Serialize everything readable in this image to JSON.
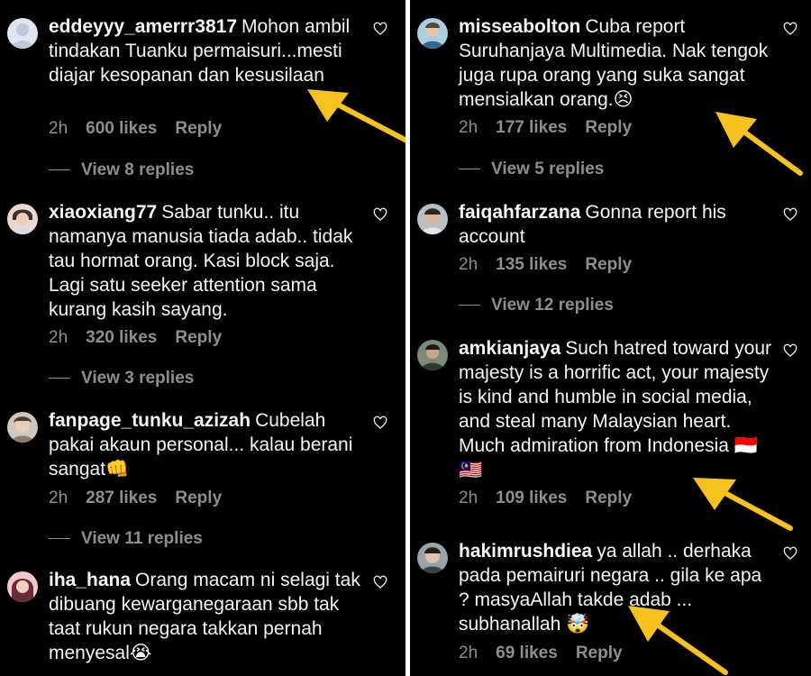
{
  "accent_color": "#f7c21e",
  "left_comments": [
    {
      "username": "eddeyyy_amerrr3817",
      "text": "Mohon ambil tindakan Tuanku permaisuri...mesti diajar kesopanan dan kesusilaan",
      "time": "2h",
      "likes": "600 likes",
      "reply": "Reply",
      "view_replies": "View 8 replies"
    },
    {
      "username": "xiaoxiang77",
      "text": "Sabar tunku.. itu namanya manusia tiada adab.. tidak tau hormat orang. Kasi block saja. Lagi satu seeker attention sama kurang kasih sayang.",
      "time": "2h",
      "likes": "320 likes",
      "reply": "Reply",
      "view_replies": "View 3 replies"
    },
    {
      "username": "fanpage_tunku_azizah",
      "text": "Cubelah pakai akaun personal... kalau berani sangat👊",
      "time": "2h",
      "likes": "287 likes",
      "reply": "Reply",
      "view_replies": "View 11 replies"
    },
    {
      "username": "iha_hana",
      "text": "Orang macam ni selagi tak dibuang kewarganegaraan sbb tak taat rukun negara takkan pernah menyesal😭"
    }
  ],
  "right_comments": [
    {
      "username": "misseabolton",
      "text": "Cuba report Suruhanjaya Multimedia. Nak tengok juga rupa orang yang suka sangat mensialkan orang.😣",
      "time": "2h",
      "likes": "177 likes",
      "reply": "Reply",
      "view_replies": "View 5 replies"
    },
    {
      "username": "faiqahfarzana",
      "text": "Gonna report his account",
      "time": "2h",
      "likes": "135 likes",
      "reply": "Reply",
      "view_replies": "View 12 replies"
    },
    {
      "username": "amkianjaya",
      "text": "Such hatred toward your majesty is a horrific act, your majesty is kind and humble in social media, and steal many Malaysian heart. Much admiration from Indonesia 🇮🇩 🇲🇾",
      "time": "2h",
      "likes": "109 likes",
      "reply": "Reply"
    },
    {
      "username": "hakimrushdiea",
      "text": "ya allah .. derhaka pada pemairuri negara .. gila ke apa ? masyaAllah takde adab ... subhanallah 🤯",
      "time": "2h",
      "likes": "69 likes",
      "reply": "Reply"
    }
  ]
}
